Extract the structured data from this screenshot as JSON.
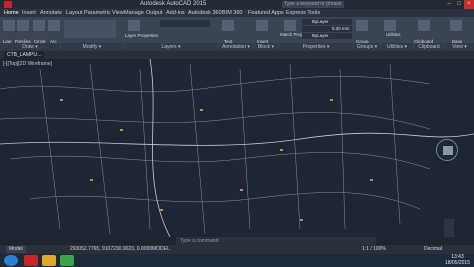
{
  "window": {
    "title": "Autodesk AutoCAD 2015",
    "search_placeholder": "Type a keyword or phrase"
  },
  "ribbon_tabs": [
    "Home",
    "Insert",
    "Annotate",
    "Layout",
    "Parametric",
    "View",
    "Manage",
    "Output",
    "Add-ins",
    "Autodesk 360",
    "BIM 360",
    "Featured Apps",
    "Express Tools"
  ],
  "active_tab": "Home",
  "ribbon": {
    "draw_buttons": [
      "Line",
      "Polyline",
      "Circle",
      "Arc"
    ],
    "layer_label": "Layer Properties",
    "text_label": "Text",
    "insert_label": "Insert",
    "match_label": "Match Properties",
    "bylayer": "ByLayer",
    "lineweight": "0.30 mm",
    "group_label": "Group",
    "utilities_label": "Utilities",
    "clipboard_label": "Clipboard",
    "base_label": "Base",
    "panels": [
      "Draw ▾",
      "Modify ▾",
      "Layers ▾",
      "Annotation ▾",
      "Block ▾",
      "Properties ▾",
      "Groups ▾",
      "Utilities ▾",
      "Clipboard",
      "View ▾"
    ]
  },
  "doc_tab": "CTB_LAMPU…",
  "viewport_label": "[-][Top][2D Wireframe]",
  "viewcube": {
    "top": "N",
    "right": "E",
    "bottom": "S",
    "left": "W",
    "face": "TOP",
    "wcs": "WCS"
  },
  "command_placeholder": "Type a command",
  "status": {
    "model_tab": "Model",
    "coords": "293052.7765, 9107230.9023, 0.0000",
    "model_label": "MODEL",
    "scale": "1:1 / 100%",
    "units": "Decimal"
  },
  "taskbar": {
    "time": "13:43",
    "date": "18/05/2015",
    "lang": "IN"
  }
}
